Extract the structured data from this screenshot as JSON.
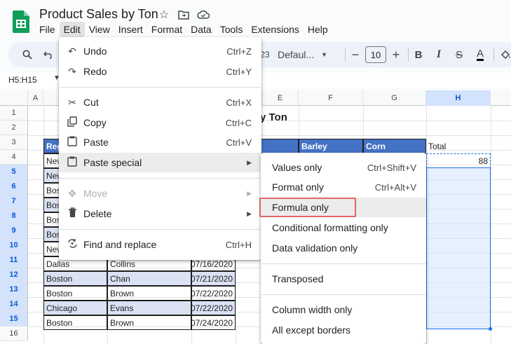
{
  "app": {
    "title": "Product Sales by Ton",
    "menu": [
      "File",
      "Edit",
      "View",
      "Insert",
      "Format",
      "Data",
      "Tools",
      "Extensions",
      "Help"
    ],
    "active_menu": "Edit"
  },
  "toolbar": {
    "number_format_fragment": "23",
    "font": "Defaul...",
    "font_size": "10",
    "minus": "−",
    "plus": "+",
    "bold": "B",
    "italic": "I",
    "strike": "S",
    "text_color": "A"
  },
  "namebox": {
    "value": "H5:H15"
  },
  "grid": {
    "col_headers": [
      "A",
      "E",
      "F",
      "G",
      "H"
    ],
    "row_numbers": [
      "1",
      "2",
      "3",
      "4",
      "5",
      "6",
      "7",
      "8",
      "9",
      "10",
      "11",
      "12",
      "13",
      "14",
      "15",
      "16"
    ],
    "title_fragment": "y Ton",
    "header_fragment_a": "Reg",
    "header_barley": "Barley",
    "header_corn": "Corn",
    "total_label": "Total",
    "total_value": "88",
    "partial_regions": [
      "New",
      "New",
      "Bos",
      "Bos",
      "Bos",
      "Bos",
      "New"
    ],
    "rows": [
      {
        "region": "Dallas",
        "rep": "Collins",
        "date": "07/16/2020"
      },
      {
        "region": "Boston",
        "rep": "Chan",
        "date": "07/21/2020"
      },
      {
        "region": "Boston",
        "rep": "Brown",
        "date": "07/22/2020"
      },
      {
        "region": "Chicago",
        "rep": "Evans",
        "date": "07/22/2020"
      },
      {
        "region": "Boston",
        "rep": "Brown",
        "date": "07/24/2020"
      }
    ]
  },
  "edit_menu": {
    "undo": {
      "label": "Undo",
      "shortcut": "Ctrl+Z"
    },
    "redo": {
      "label": "Redo",
      "shortcut": "Ctrl+Y"
    },
    "cut": {
      "label": "Cut",
      "shortcut": "Ctrl+X"
    },
    "copy": {
      "label": "Copy",
      "shortcut": "Ctrl+C"
    },
    "paste": {
      "label": "Paste",
      "shortcut": "Ctrl+V"
    },
    "paste_special": {
      "label": "Paste special"
    },
    "move": {
      "label": "Move"
    },
    "delete": {
      "label": "Delete"
    },
    "find_replace": {
      "label": "Find and replace",
      "shortcut": "Ctrl+H"
    }
  },
  "paste_special_menu": {
    "values_only": {
      "label": "Values only",
      "shortcut": "Ctrl+Shift+V"
    },
    "format_only": {
      "label": "Format only",
      "shortcut": "Ctrl+Alt+V"
    },
    "formula_only": {
      "label": "Formula only"
    },
    "conditional_formatting_only": {
      "label": "Conditional formatting only"
    },
    "data_validation_only": {
      "label": "Data validation only"
    },
    "transposed": {
      "label": "Transposed"
    },
    "column_width_only": {
      "label": "Column width only"
    },
    "all_except_borders": {
      "label": "All except borders"
    }
  },
  "colors": {
    "header_fill": "#4472c4",
    "band_fill": "#d9e1f2",
    "selection": "#1a73e8",
    "callout_border": "#e06666",
    "logo_green": "#0f9d58"
  }
}
